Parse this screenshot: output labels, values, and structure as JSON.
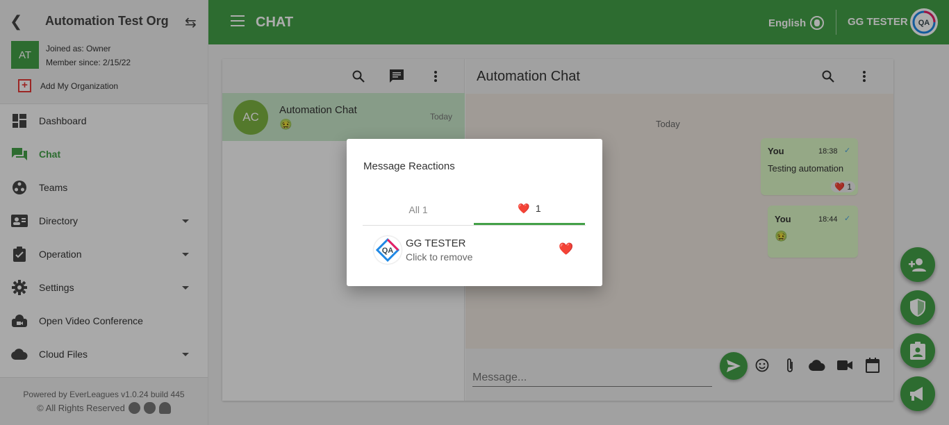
{
  "sidebar": {
    "org_name": "Automation Test Org",
    "org_initials": "AT",
    "joined_as": "Joined as: Owner",
    "member_since": "Member since: 2/15/22",
    "add_org_label": "Add My Organization",
    "items": [
      {
        "label": "Dashboard",
        "icon": "dashboard-icon"
      },
      {
        "label": "Chat",
        "icon": "chat-icon",
        "active": true
      },
      {
        "label": "Teams",
        "icon": "teams-icon"
      },
      {
        "label": "Directory",
        "icon": "directory-icon",
        "has_submenu": true
      },
      {
        "label": "Operation",
        "icon": "clipboard-check-icon",
        "has_submenu": true
      },
      {
        "label": "Settings",
        "icon": "gear-icon",
        "has_submenu": true
      },
      {
        "label": "Open Video Conference",
        "icon": "video-conference-icon"
      },
      {
        "label": "Cloud Files",
        "icon": "cloud-icon",
        "has_submenu": true
      }
    ],
    "footer_powered": "Powered by EverLeagues v1.0.24 build 445",
    "footer_rights": "© All Rights Reserved"
  },
  "topbar": {
    "title": "CHAT",
    "language": "English",
    "user_name": "GG TESTER",
    "user_avatar_text": "QA"
  },
  "chat_list": {
    "conversation": {
      "initials": "AC",
      "name": "Automation Chat",
      "last_message": "🤢",
      "time": "Today"
    }
  },
  "conversation": {
    "title": "Automation Chat",
    "day_label": "Today",
    "messages": [
      {
        "sender": "You",
        "time": "18:38",
        "text": "Testing automation",
        "reaction": "❤️",
        "reaction_count": "1"
      },
      {
        "sender": "You",
        "time": "18:44",
        "text": "🤢"
      }
    ],
    "composer_placeholder": "Message..."
  },
  "dialog": {
    "title": "Message Reactions",
    "tab_all": "All 1",
    "tab_heart_emoji": "❤️",
    "tab_heart_count": "1",
    "reactor_name": "GG TESTER",
    "reactor_hint": "Click to remove",
    "reactor_avatar_text": "QA",
    "reactor_emoji": "❤️"
  },
  "colors": {
    "brand_green": "#43a047",
    "bubble_green": "#dcf8c6",
    "selected_conversation": "#c8e6c9"
  }
}
